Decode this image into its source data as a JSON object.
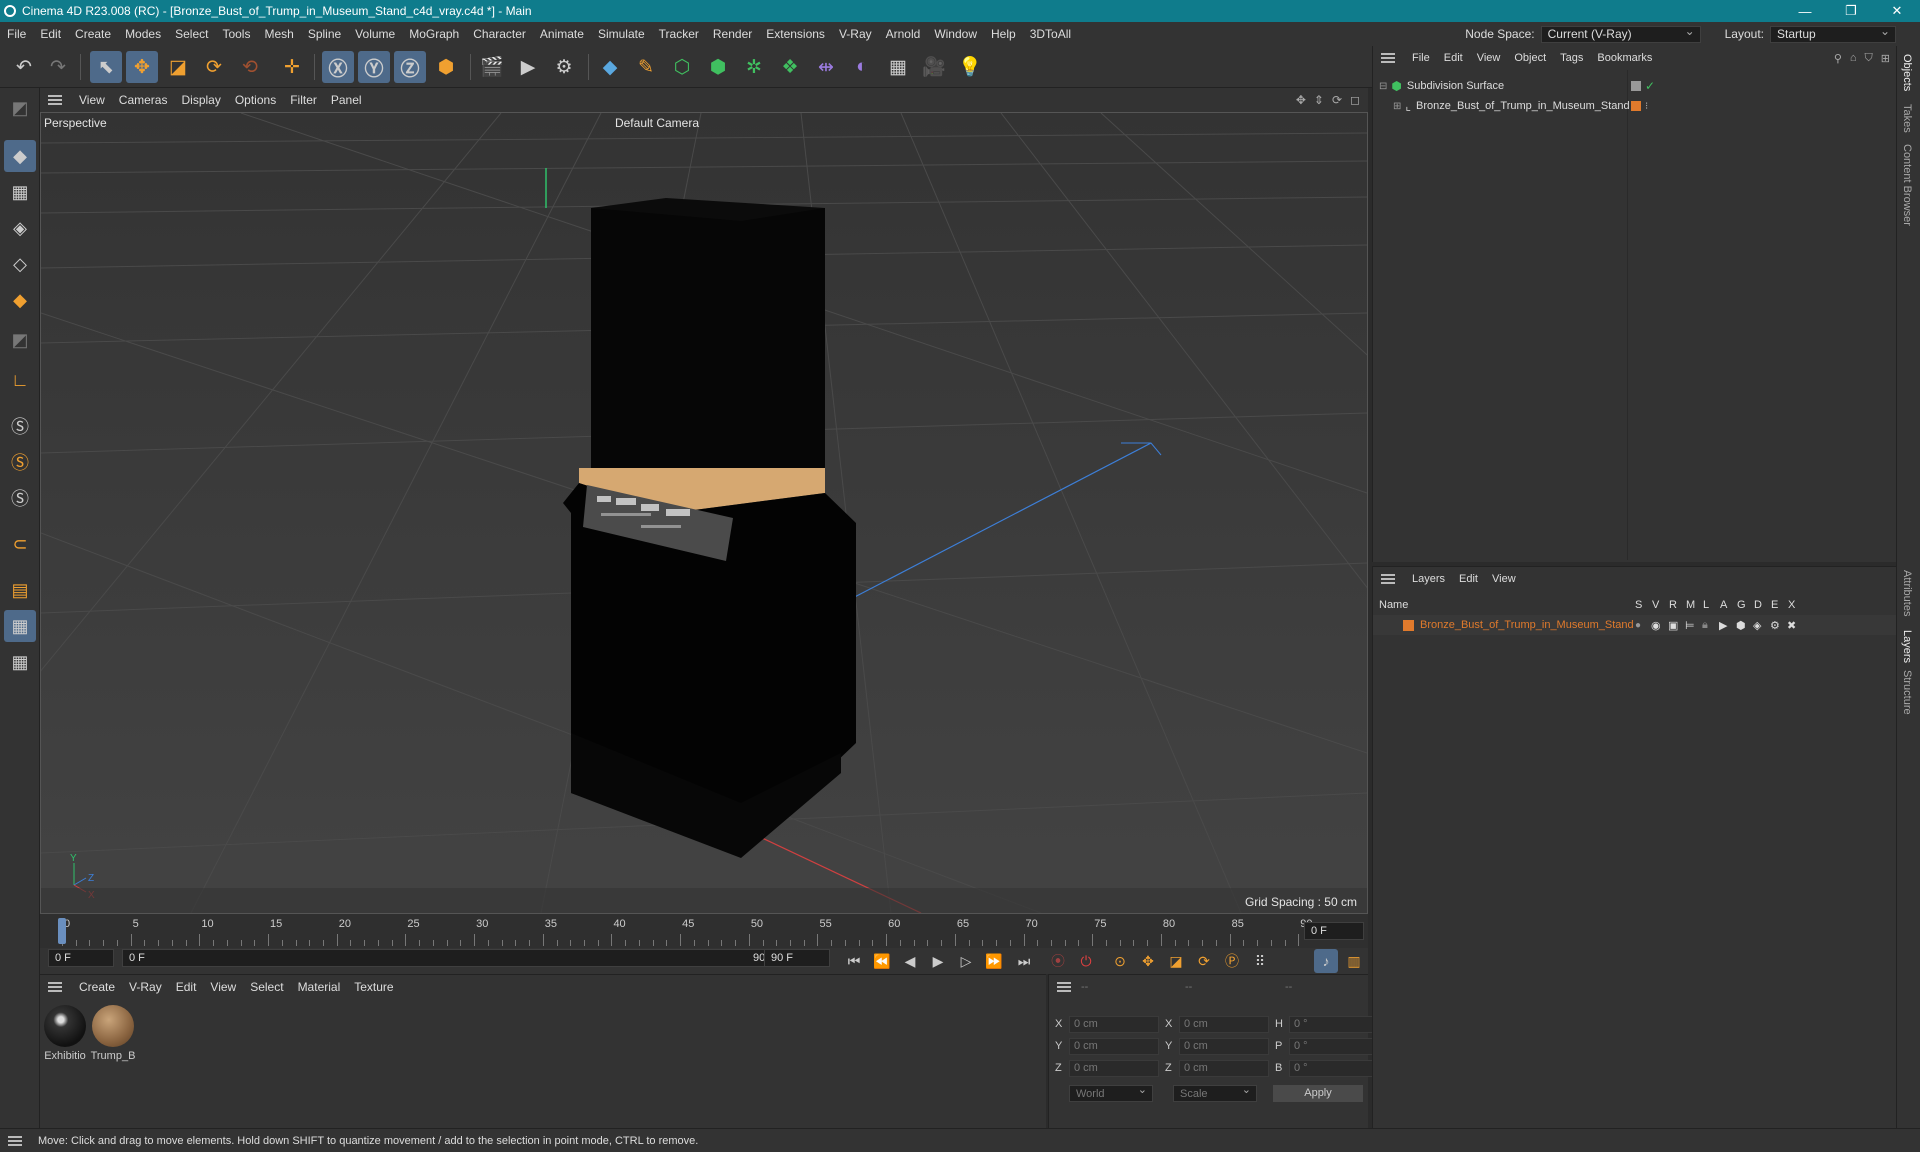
{
  "window": {
    "title": "Cinema 4D R23.008 (RC) - [Bronze_Bust_of_Trump_in_Museum_Stand_c4d_vray.c4d *] - Main"
  },
  "menu": [
    "File",
    "Edit",
    "Create",
    "Modes",
    "Select",
    "Tools",
    "Mesh",
    "Spline",
    "Volume",
    "MoGraph",
    "Character",
    "Animate",
    "Simulate",
    "Tracker",
    "Render",
    "Extensions",
    "V-Ray",
    "Arnold",
    "Window",
    "Help",
    "3DToAll"
  ],
  "node_space": {
    "label": "Node Space:",
    "value": "Current (V-Ray)"
  },
  "layout": {
    "label": "Layout:",
    "value": "Startup"
  },
  "viewport": {
    "menu": [
      "View",
      "Cameras",
      "Display",
      "Options",
      "Filter",
      "Panel"
    ],
    "name": "Perspective",
    "camera": "Default Camera",
    "grid_spacing": "Grid Spacing : 50 cm",
    "axis_y": "Y",
    "axis_z": "Z",
    "axis_x": "X"
  },
  "timeline": {
    "ticks": [
      "0",
      "5",
      "10",
      "15",
      "20",
      "25",
      "30",
      "35",
      "40",
      "45",
      "50",
      "55",
      "60",
      "65",
      "70",
      "75",
      "80",
      "85",
      "90"
    ],
    "current_frame": "0 F"
  },
  "playbar": {
    "start": "0 F",
    "range_start": "0 F",
    "range_end": "90 F",
    "end": "90 F"
  },
  "materials": {
    "menu": [
      "Create",
      "V-Ray",
      "Edit",
      "View",
      "Select",
      "Material",
      "Texture"
    ],
    "items": [
      {
        "name": "Exhibitio"
      },
      {
        "name": "Trump_B"
      }
    ]
  },
  "coords": {
    "header": [
      "--",
      "--",
      "--"
    ],
    "rows": [
      {
        "a": "X",
        "av": "0 cm",
        "b": "X",
        "bv": "0 cm",
        "c": "H",
        "cv": "0 °"
      },
      {
        "a": "Y",
        "av": "0 cm",
        "b": "Y",
        "bv": "0 cm",
        "c": "P",
        "cv": "0 °"
      },
      {
        "a": "Z",
        "av": "0 cm",
        "b": "Z",
        "bv": "0 cm",
        "c": "B",
        "cv": "0 °"
      }
    ],
    "mode": "World",
    "size_mode": "Scale",
    "apply": "Apply"
  },
  "objects": {
    "menu": [
      "File",
      "Edit",
      "View",
      "Object",
      "Tags",
      "Bookmarks"
    ],
    "items": [
      {
        "name": "Subdivision Surface"
      },
      {
        "name": "Bronze_Bust_of_Trump_in_Museum_Stand"
      }
    ]
  },
  "layers": {
    "menu": [
      "Layers",
      "Edit",
      "View"
    ],
    "header_name": "Name",
    "columns": [
      "S",
      "V",
      "R",
      "M",
      "L",
      "A",
      "G",
      "D",
      "E",
      "X"
    ],
    "items": [
      {
        "name": "Bronze_Bust_of_Trump_in_Museum_Stand",
        "color": "#e07a2c"
      }
    ]
  },
  "right_tabs": [
    "Objects",
    "Takes",
    "Content Browser",
    "Attributes",
    "Layers",
    "Structure"
  ],
  "status": "Move: Click and drag to move elements. Hold down SHIFT to quantize movement / add to the selection in point mode, CTRL to remove.",
  "colors": {
    "titlebar": "#0f7c8c",
    "accent": "#4e6a8a",
    "layer_orange": "#e07a2c"
  }
}
